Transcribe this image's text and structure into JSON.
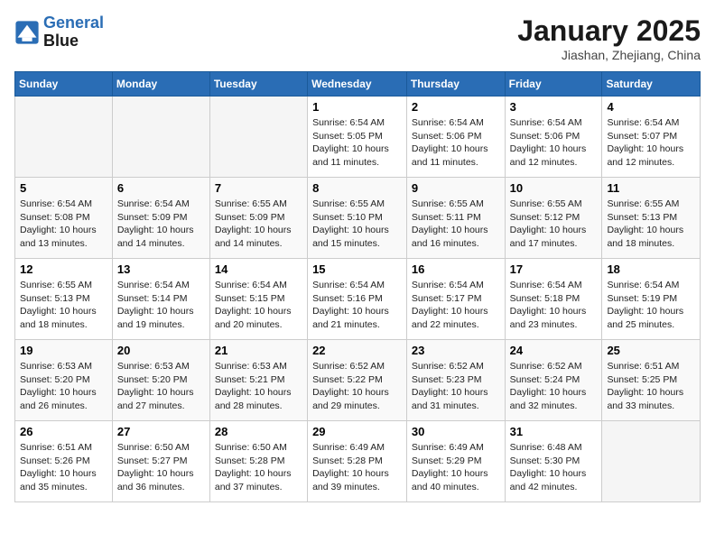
{
  "logo": {
    "line1": "General",
    "line2": "Blue"
  },
  "title": "January 2025",
  "subtitle": "Jiashan, Zhejiang, China",
  "days_of_week": [
    "Sunday",
    "Monday",
    "Tuesday",
    "Wednesday",
    "Thursday",
    "Friday",
    "Saturday"
  ],
  "weeks": [
    [
      {
        "day": "",
        "info": ""
      },
      {
        "day": "",
        "info": ""
      },
      {
        "day": "",
        "info": ""
      },
      {
        "day": "1",
        "info": "Sunrise: 6:54 AM\nSunset: 5:05 PM\nDaylight: 10 hours\nand 11 minutes."
      },
      {
        "day": "2",
        "info": "Sunrise: 6:54 AM\nSunset: 5:06 PM\nDaylight: 10 hours\nand 11 minutes."
      },
      {
        "day": "3",
        "info": "Sunrise: 6:54 AM\nSunset: 5:06 PM\nDaylight: 10 hours\nand 12 minutes."
      },
      {
        "day": "4",
        "info": "Sunrise: 6:54 AM\nSunset: 5:07 PM\nDaylight: 10 hours\nand 12 minutes."
      }
    ],
    [
      {
        "day": "5",
        "info": "Sunrise: 6:54 AM\nSunset: 5:08 PM\nDaylight: 10 hours\nand 13 minutes."
      },
      {
        "day": "6",
        "info": "Sunrise: 6:54 AM\nSunset: 5:09 PM\nDaylight: 10 hours\nand 14 minutes."
      },
      {
        "day": "7",
        "info": "Sunrise: 6:55 AM\nSunset: 5:09 PM\nDaylight: 10 hours\nand 14 minutes."
      },
      {
        "day": "8",
        "info": "Sunrise: 6:55 AM\nSunset: 5:10 PM\nDaylight: 10 hours\nand 15 minutes."
      },
      {
        "day": "9",
        "info": "Sunrise: 6:55 AM\nSunset: 5:11 PM\nDaylight: 10 hours\nand 16 minutes."
      },
      {
        "day": "10",
        "info": "Sunrise: 6:55 AM\nSunset: 5:12 PM\nDaylight: 10 hours\nand 17 minutes."
      },
      {
        "day": "11",
        "info": "Sunrise: 6:55 AM\nSunset: 5:13 PM\nDaylight: 10 hours\nand 18 minutes."
      }
    ],
    [
      {
        "day": "12",
        "info": "Sunrise: 6:55 AM\nSunset: 5:13 PM\nDaylight: 10 hours\nand 18 minutes."
      },
      {
        "day": "13",
        "info": "Sunrise: 6:54 AM\nSunset: 5:14 PM\nDaylight: 10 hours\nand 19 minutes."
      },
      {
        "day": "14",
        "info": "Sunrise: 6:54 AM\nSunset: 5:15 PM\nDaylight: 10 hours\nand 20 minutes."
      },
      {
        "day": "15",
        "info": "Sunrise: 6:54 AM\nSunset: 5:16 PM\nDaylight: 10 hours\nand 21 minutes."
      },
      {
        "day": "16",
        "info": "Sunrise: 6:54 AM\nSunset: 5:17 PM\nDaylight: 10 hours\nand 22 minutes."
      },
      {
        "day": "17",
        "info": "Sunrise: 6:54 AM\nSunset: 5:18 PM\nDaylight: 10 hours\nand 23 minutes."
      },
      {
        "day": "18",
        "info": "Sunrise: 6:54 AM\nSunset: 5:19 PM\nDaylight: 10 hours\nand 25 minutes."
      }
    ],
    [
      {
        "day": "19",
        "info": "Sunrise: 6:53 AM\nSunset: 5:20 PM\nDaylight: 10 hours\nand 26 minutes."
      },
      {
        "day": "20",
        "info": "Sunrise: 6:53 AM\nSunset: 5:20 PM\nDaylight: 10 hours\nand 27 minutes."
      },
      {
        "day": "21",
        "info": "Sunrise: 6:53 AM\nSunset: 5:21 PM\nDaylight: 10 hours\nand 28 minutes."
      },
      {
        "day": "22",
        "info": "Sunrise: 6:52 AM\nSunset: 5:22 PM\nDaylight: 10 hours\nand 29 minutes."
      },
      {
        "day": "23",
        "info": "Sunrise: 6:52 AM\nSunset: 5:23 PM\nDaylight: 10 hours\nand 31 minutes."
      },
      {
        "day": "24",
        "info": "Sunrise: 6:52 AM\nSunset: 5:24 PM\nDaylight: 10 hours\nand 32 minutes."
      },
      {
        "day": "25",
        "info": "Sunrise: 6:51 AM\nSunset: 5:25 PM\nDaylight: 10 hours\nand 33 minutes."
      }
    ],
    [
      {
        "day": "26",
        "info": "Sunrise: 6:51 AM\nSunset: 5:26 PM\nDaylight: 10 hours\nand 35 minutes."
      },
      {
        "day": "27",
        "info": "Sunrise: 6:50 AM\nSunset: 5:27 PM\nDaylight: 10 hours\nand 36 minutes."
      },
      {
        "day": "28",
        "info": "Sunrise: 6:50 AM\nSunset: 5:28 PM\nDaylight: 10 hours\nand 37 minutes."
      },
      {
        "day": "29",
        "info": "Sunrise: 6:49 AM\nSunset: 5:28 PM\nDaylight: 10 hours\nand 39 minutes."
      },
      {
        "day": "30",
        "info": "Sunrise: 6:49 AM\nSunset: 5:29 PM\nDaylight: 10 hours\nand 40 minutes."
      },
      {
        "day": "31",
        "info": "Sunrise: 6:48 AM\nSunset: 5:30 PM\nDaylight: 10 hours\nand 42 minutes."
      },
      {
        "day": "",
        "info": ""
      }
    ]
  ]
}
